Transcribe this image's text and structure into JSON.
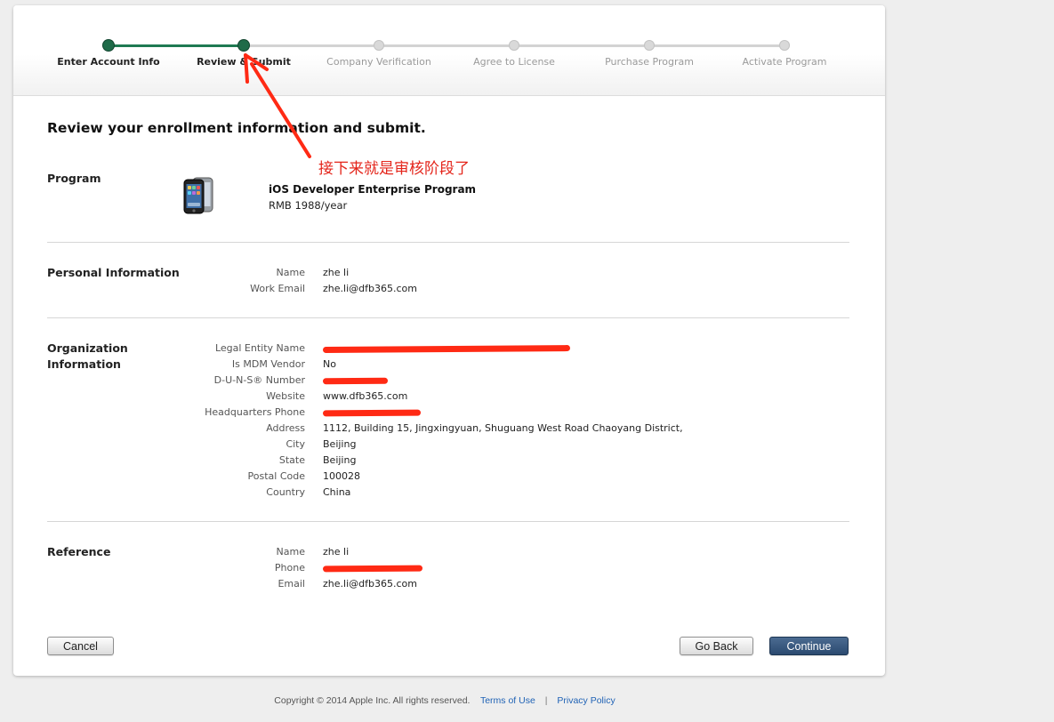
{
  "progress": {
    "steps": [
      {
        "label": "Enter Account Info",
        "done": true
      },
      {
        "label": "Review & Submit",
        "done": true
      },
      {
        "label": "Company Verification",
        "done": false
      },
      {
        "label": "Agree to License",
        "done": false
      },
      {
        "label": "Purchase Program",
        "done": false
      },
      {
        "label": "Activate Program",
        "done": false
      }
    ],
    "accent_color": "#1f6b49"
  },
  "page": {
    "heading": "Review your enrollment information and submit."
  },
  "annotation": {
    "text": "接下来就是审核阶段了",
    "color": "#e4251b"
  },
  "program": {
    "title": "Program",
    "icon": "iphone-icon",
    "name": "iOS Developer Enterprise Program",
    "price": "RMB 1988/year"
  },
  "personal": {
    "title": "Personal Information",
    "fields": [
      {
        "label": "Name",
        "value": "zhe li"
      },
      {
        "label": "Work Email",
        "value": "zhe.li@dfb365.com"
      }
    ]
  },
  "organization": {
    "title_line1": "Organization",
    "title_line2": "Information",
    "fields": [
      {
        "label": "Legal Entity Name",
        "value": "",
        "redacted": true
      },
      {
        "label": "Is MDM Vendor",
        "value": "No"
      },
      {
        "label": "D-U-N-S® Number",
        "value": "",
        "redacted": true
      },
      {
        "label": "Website",
        "value": "www.dfb365.com"
      },
      {
        "label": "Headquarters Phone",
        "value": "",
        "redacted": true
      },
      {
        "label": "Address",
        "value": "1112, Building 15, Jingxingyuan, Shuguang West Road Chaoyang District,"
      },
      {
        "label": "City",
        "value": "Beijing"
      },
      {
        "label": "State",
        "value": "Beijing"
      },
      {
        "label": "Postal Code",
        "value": "100028"
      },
      {
        "label": "Country",
        "value": "China"
      }
    ]
  },
  "reference": {
    "title": "Reference",
    "fields": [
      {
        "label": "Name",
        "value": "zhe li"
      },
      {
        "label": "Phone",
        "value": "",
        "redacted": true
      },
      {
        "label": "Email",
        "value": "zhe.li@dfb365.com"
      }
    ]
  },
  "buttons": {
    "cancel": "Cancel",
    "go_back": "Go Back",
    "continue": "Continue"
  },
  "footer": {
    "copyright": "Copyright © 2014 Apple Inc. All rights reserved.",
    "terms": "Terms of Use",
    "separator": "|",
    "privacy": "Privacy Policy"
  }
}
